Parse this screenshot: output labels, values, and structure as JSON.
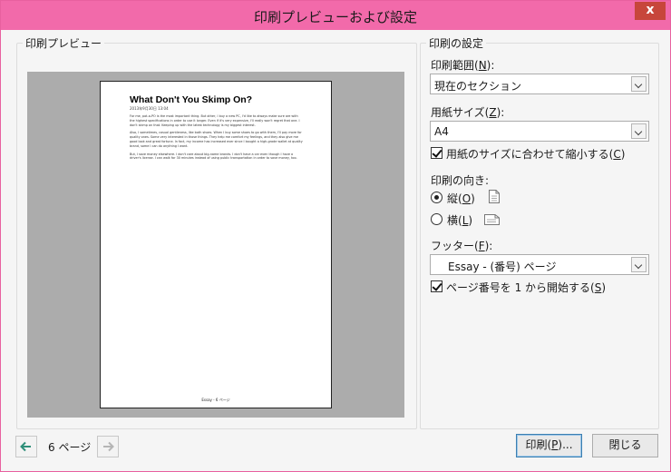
{
  "window": {
    "title": "印刷プレビューおよび設定",
    "close_glyph": "x"
  },
  "preview": {
    "group_label": "印刷プレビュー",
    "page": {
      "title": "What Don't You Skimp On?",
      "date": "2013年9月30日    13:04",
      "paragraphs": [
        "For me, pot-a-PO is the most important thing. But other, I buy a new PC, I'd like to always make sure are with the highest specifications in order to use it longer. Even if it's very expensive, I'll really won't regret that one. I don't skimp on that. Keeping up with the latest technology is my biggest interest.",
        "Also, I sometimes, casual gentleness, like both shoes. When I buy some shoes to go with them, I'll pay more for quality ones. Some very interested in those things. They help me comfort my feelings, and they also give me good look and great fortune. In fact, my income has increased ever since I bought a high-grade wallet at quality brand, some I can do anything I want.",
        "But, I save money elsewhere. I don't care about big-name brands. I don't have a car even though I have a driver's license. I can walk for 30 minutes instead of using public transportation in order to save money, too."
      ],
      "footer": "Essay - 6 ページ"
    },
    "page_count_label": "6 ページ"
  },
  "settings": {
    "group_label": "印刷の設定",
    "range": {
      "label": "印刷範囲(",
      "key": "N",
      "suffix": "):",
      "value": "現在のセクション"
    },
    "paper": {
      "label": "用紙サイズ(",
      "key": "Z",
      "suffix": "):",
      "value": "A4"
    },
    "shrink": {
      "label": "用紙のサイズに合わせて縮小する(",
      "key": "C",
      "suffix": ")",
      "checked": true
    },
    "orientation": {
      "label": "印刷の向き:",
      "portrait": {
        "label": "縦(",
        "key": "O",
        "suffix": ")",
        "selected": true
      },
      "landscape": {
        "label": "横(",
        "key": "L",
        "suffix": ")",
        "selected": false
      }
    },
    "footer": {
      "label": "フッター(",
      "key": "F",
      "suffix": "):",
      "value": "Essay - (番号) ページ"
    },
    "page_numbers": {
      "label": "ページ番号を 1 から開始する(",
      "key": "S",
      "suffix": ")",
      "checked": true
    }
  },
  "buttons": {
    "print": {
      "label": "印刷(",
      "key": "P",
      "suffix": ")..."
    },
    "close": "閉じる"
  },
  "colors": {
    "titlebar": "#f26aaa",
    "close": "#c7463b",
    "arrow": "#2e8f79"
  }
}
